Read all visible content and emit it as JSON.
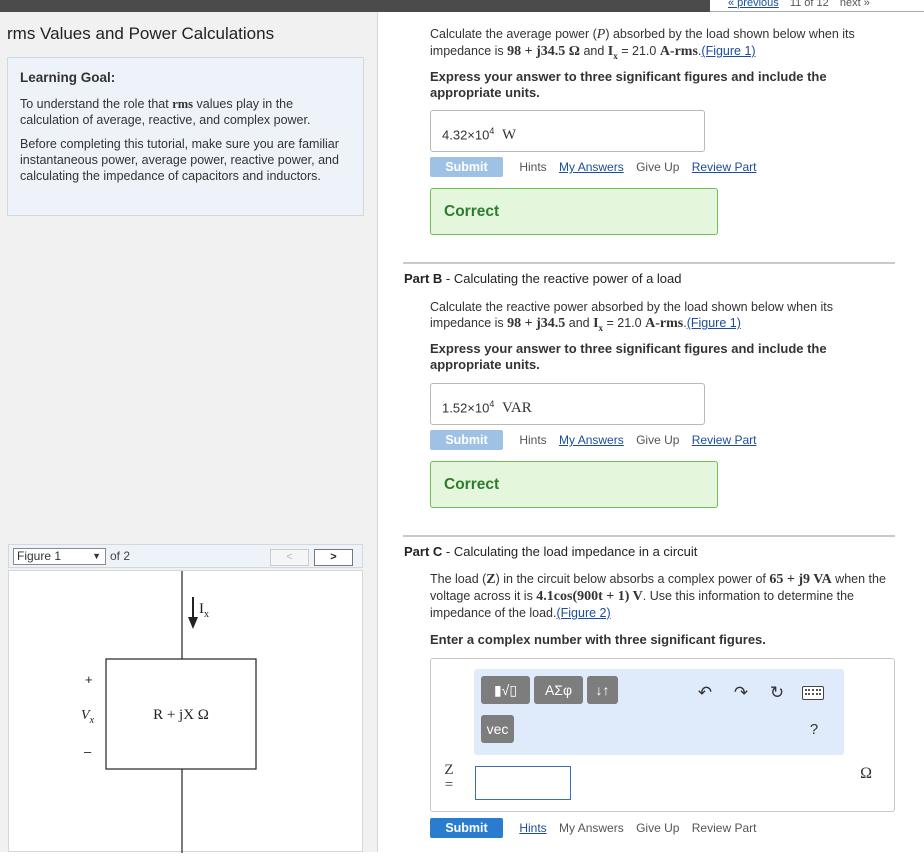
{
  "nav": {
    "previous": "« previous",
    "position": "11 of 12",
    "next": "next »"
  },
  "page_title": "rms Values and Power Calculations",
  "learning_goal": {
    "heading": "Learning Goal:",
    "p1_pre": "To understand the role that ",
    "p1_em": "rms",
    "p1_post": " values play in the calculation of average, reactive, and complex power.",
    "p2": "Before completing this tutorial, make sure you are familiar instantaneous power, average power, reactive power, and calculating the impedance of capacitors and inductors."
  },
  "figure": {
    "selected": "Figure 1",
    "of_label": "of 2",
    "prev": "<",
    "next": ">",
    "current_label": "Ix",
    "plus": "+",
    "minus": "–",
    "voltage_label": "Vx",
    "component_label": "R + jX Ω"
  },
  "part_a": {
    "q_1": "Calculate the average power (",
    "q_var": "P",
    "q_2": ") absorbed by the load shown below when its impedance is ",
    "q_imp": "98 + j34.5 Ω",
    "q_3": " and ",
    "q_ix": "Ix",
    "q_4": " = 21.0 ",
    "q_unit": "A-rms",
    "q_5": ".",
    "figure_link": "(Figure 1)",
    "instruction": "Express your answer to three significant figures and include the appropriate units.",
    "answer_mantissa": "4.32×10",
    "answer_exp": "4",
    "answer_unit": "W",
    "feedback": "Correct"
  },
  "part_b": {
    "title_prefix": "Part B",
    "title_text": " - Calculating the reactive power of a load",
    "q_1": "Calculate the reactive power absorbed by the load shown below when its impedance is ",
    "q_imp": "98 + j34.5",
    "q_2": " and ",
    "q_ix": "Ix",
    "q_3": " = 21.0 ",
    "q_unit": "A-rms",
    "q_4": ".",
    "figure_link": "(Figure 1)",
    "instruction": "Express your answer to three significant figures and include the appropriate units.",
    "answer_mantissa": "1.52×10",
    "answer_exp": "4",
    "answer_unit": "VAR",
    "feedback": "Correct"
  },
  "part_c": {
    "title_prefix": "Part C",
    "title_text": " - Calculating the load impedance in a circuit",
    "q_1": "The load (",
    "q_z": "Z",
    "q_2": ") in the circuit below absorbs a complex power of ",
    "q_power": "65 + j9 VA",
    "q_3": " when the voltage across it is ",
    "q_voltage": "4.1cos(900t + 1) V",
    "q_4": ". Use this information to determine the impedance of the load.",
    "figure_link": "(Figure 2)",
    "instruction": "Enter a complex number with three significant figures.",
    "var_label": "Z",
    "equals": "=",
    "unit": "Ω"
  },
  "actions": {
    "submit": "Submit",
    "hints": "Hints",
    "my_answers": "My Answers",
    "give_up": "Give Up",
    "review_part": "Review Part"
  },
  "editor_toolbar": {
    "templates": "▮√▯",
    "greek": "ΑΣφ",
    "sort": "↓↑",
    "vec": "vec",
    "undo": "↶",
    "redo": "↷",
    "reset": "↻",
    "help": "?"
  }
}
